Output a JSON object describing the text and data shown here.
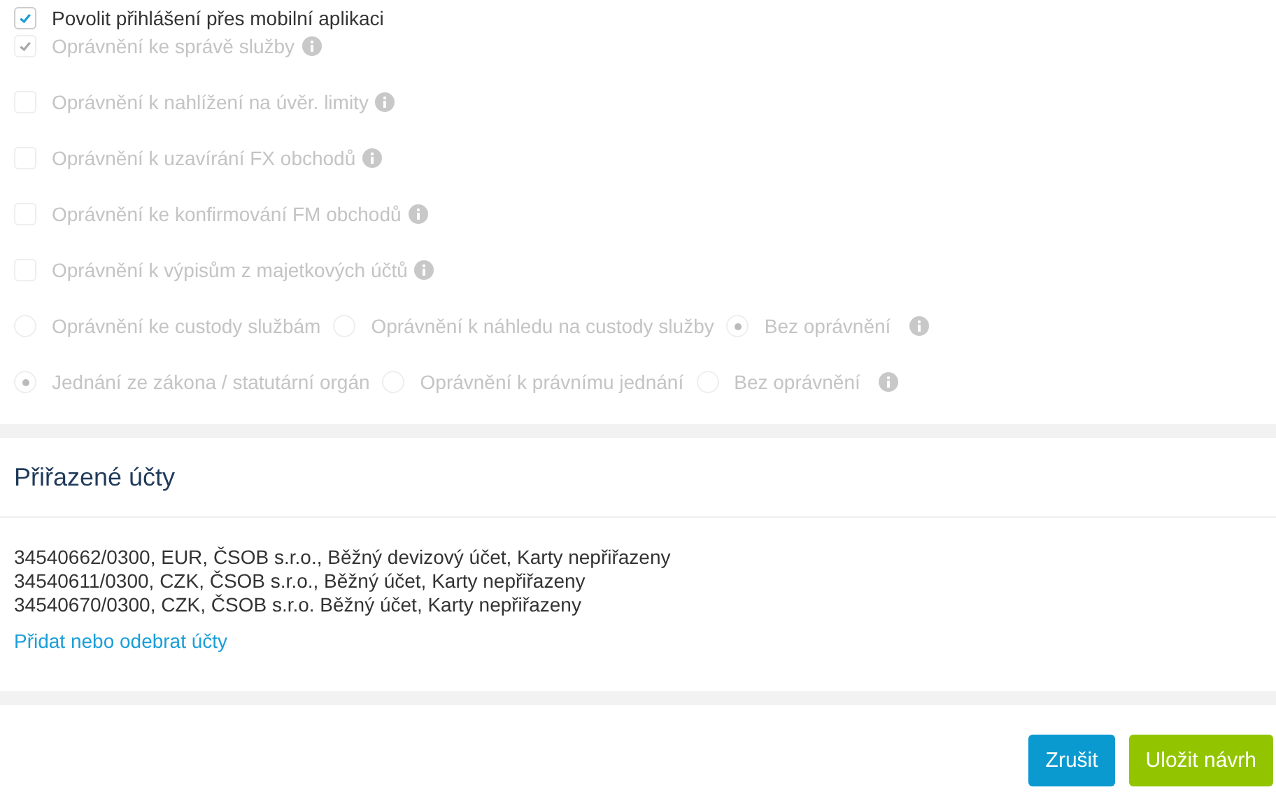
{
  "checkboxes": [
    {
      "label": "Povolit přihlášení přes mobilní aplikaci",
      "checked": true,
      "disabled": false,
      "info": false
    },
    {
      "label": "Oprávnění ke správě služby",
      "checked": true,
      "disabled": true,
      "info": true
    },
    {
      "label": "Oprávnění k nahlížení na úvěr. limity",
      "checked": false,
      "disabled": true,
      "info": true
    },
    {
      "label": "Oprávnění k uzavírání FX obchodů",
      "checked": false,
      "disabled": true,
      "info": true
    },
    {
      "label": "Oprávnění ke konfirmování FM obchodů",
      "checked": false,
      "disabled": true,
      "info": true
    },
    {
      "label": "Oprávnění k výpisům z majetkových účtů",
      "checked": false,
      "disabled": true,
      "info": true
    }
  ],
  "radio_groups": [
    {
      "disabled": true,
      "info": true,
      "options": [
        {
          "label": "Oprávnění ke custody službám",
          "selected": false
        },
        {
          "label": "Oprávnění k náhledu na custody služby",
          "selected": false
        },
        {
          "label": "Bez oprávnění",
          "selected": true
        }
      ]
    },
    {
      "disabled": true,
      "info": true,
      "options": [
        {
          "label": "Jednání ze zákona / statutární orgán",
          "selected": true
        },
        {
          "label": "Oprávnění k právnímu jednání",
          "selected": false
        },
        {
          "label": "Bez oprávnění",
          "selected": false
        }
      ]
    }
  ],
  "accounts_section": {
    "title": "Přiřazené účty",
    "accounts": [
      "34540662/0300, EUR, ČSOB s.r.o., Běžný devizový účet, Karty nepřiřazeny",
      "34540611/0300, CZK, ČSOB s.r.o., Běžný účet, Karty nepřiřazeny",
      "34540670/0300, CZK, ČSOB s.r.o. Běžný účet, Karty nepřiřazeny"
    ],
    "link": "Přidat nebo odebrat účty"
  },
  "buttons": [
    {
      "label": "Zrušit",
      "kind": "secondary"
    },
    {
      "label": "Uložit návrh",
      "kind": "primary"
    }
  ]
}
